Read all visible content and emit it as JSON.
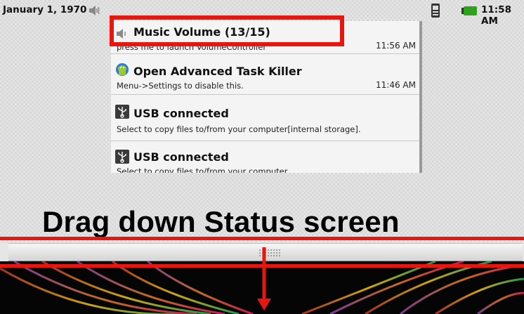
{
  "status_bar": {
    "date": "January 1, 1970",
    "time": "11:58 AM"
  },
  "notifications": [
    {
      "title": "Music Volume (13/15)",
      "description": "press me to launch VolumeController",
      "time": "11:56 AM",
      "icon": "speaker-icon"
    },
    {
      "title": "Open Advanced Task Killer",
      "description": "Menu->Settings to disable this.",
      "time": "11:46 AM",
      "icon": "android-robot-icon"
    },
    {
      "title": "USB connected",
      "description": "Select to copy files to/from your computer[internal storage].",
      "time": "",
      "icon": "usb-icon"
    },
    {
      "title": "USB connected",
      "description": "Select to copy files to/from your computer",
      "time": "",
      "icon": "usb-icon"
    }
  ],
  "caption": "Drag down Status screen",
  "colors": {
    "annotation_red": "#e8160f",
    "battery_green": "#2fa21c"
  }
}
